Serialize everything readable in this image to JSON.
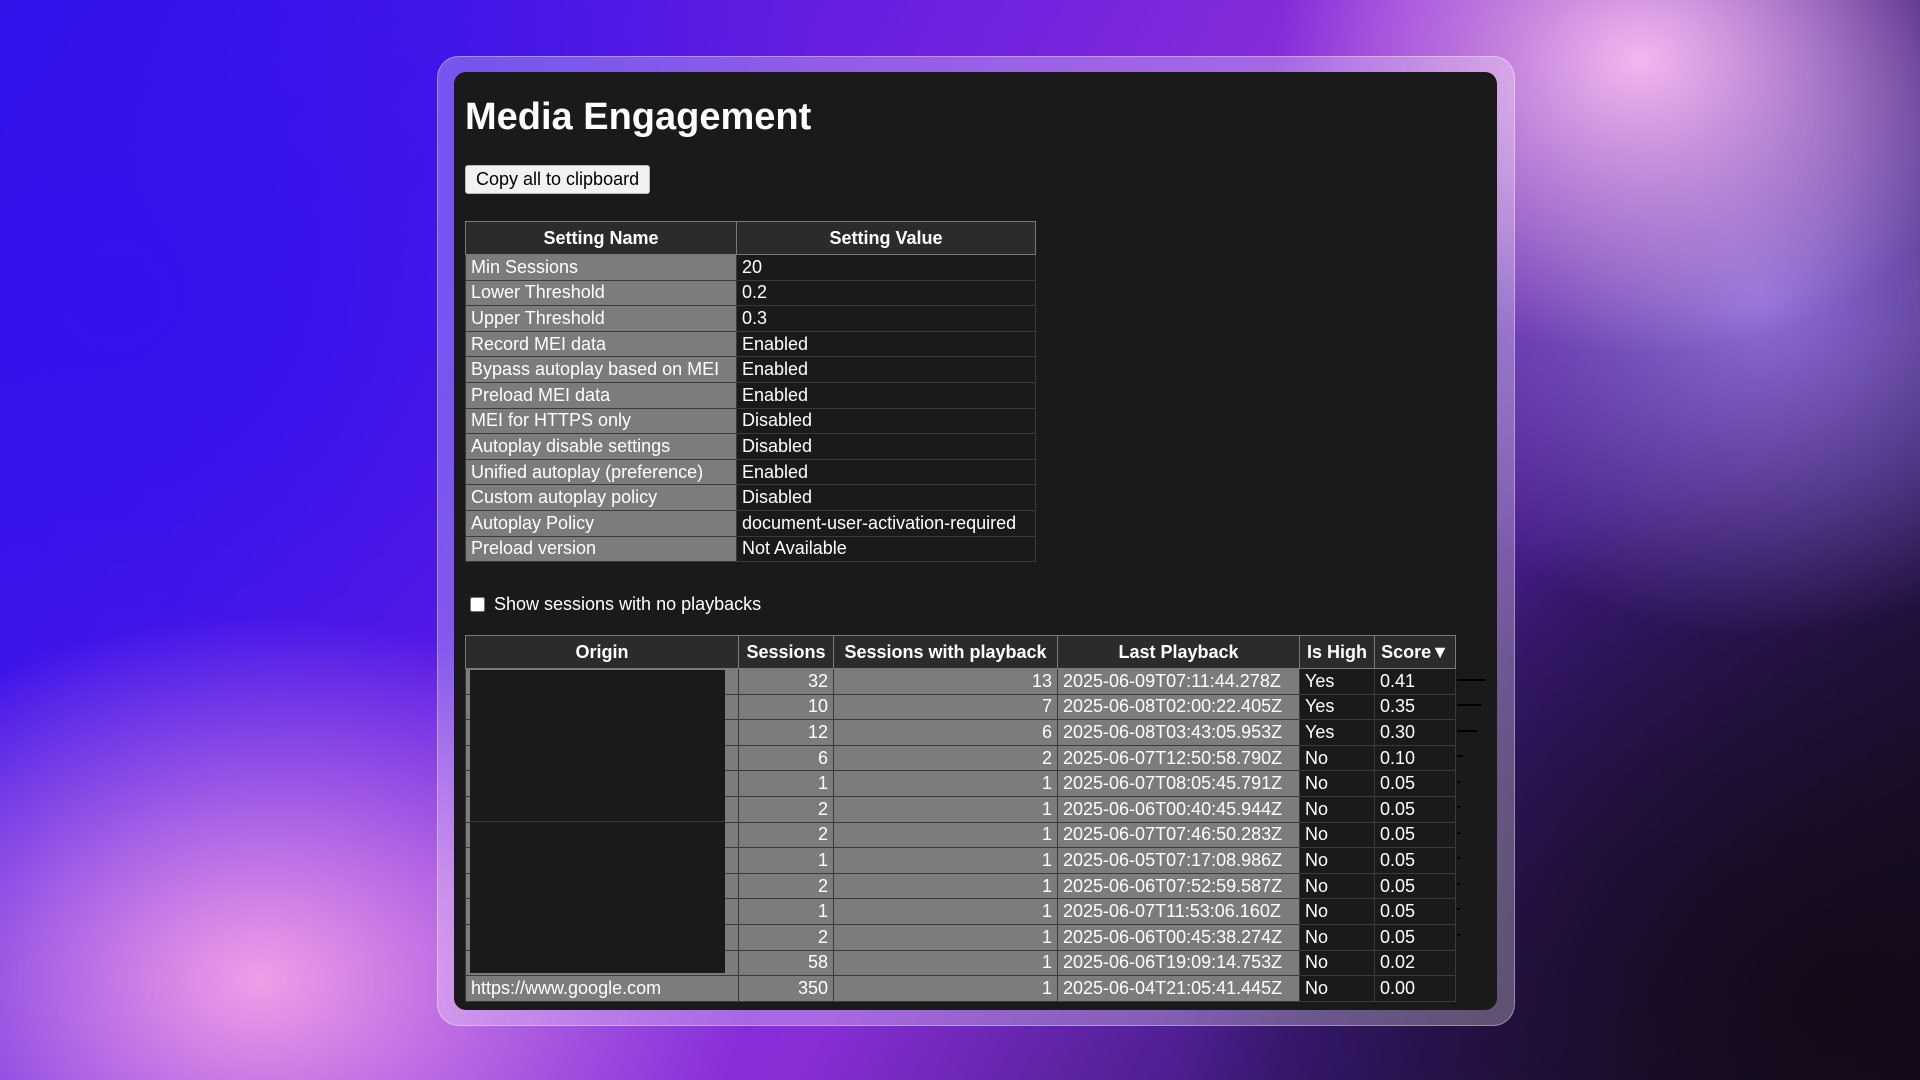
{
  "page": {
    "title": "Media Engagement",
    "copy_button": "Copy all to clipboard"
  },
  "settings": {
    "headers": [
      "Setting Name",
      "Setting Value"
    ],
    "rows": [
      {
        "name": "Min Sessions",
        "value": "20"
      },
      {
        "name": "Lower Threshold",
        "value": "0.2"
      },
      {
        "name": "Upper Threshold",
        "value": "0.3"
      },
      {
        "name": "Record MEI data",
        "value": "Enabled"
      },
      {
        "name": "Bypass autoplay based on MEI",
        "value": "Enabled"
      },
      {
        "name": "Preload MEI data",
        "value": "Enabled"
      },
      {
        "name": "MEI for HTTPS only",
        "value": "Disabled"
      },
      {
        "name": "Autoplay disable settings",
        "value": "Disabled"
      },
      {
        "name": "Unified autoplay (preference)",
        "value": "Enabled"
      },
      {
        "name": "Custom autoplay policy",
        "value": "Disabled"
      },
      {
        "name": "Autoplay Policy",
        "value": "document-user-activation-required"
      },
      {
        "name": "Preload version",
        "value": "Not Available"
      }
    ]
  },
  "show_no_playbacks": {
    "label": "Show sessions with no playbacks",
    "checked": false
  },
  "engagement": {
    "headers": [
      "Origin",
      "Sessions",
      "Sessions with playback",
      "Last Playback",
      "Is High",
      "Score▼"
    ],
    "rows": [
      {
        "origin": "",
        "sessions": "32",
        "playback": "13",
        "last": "2025-06-09T07:11:44.278Z",
        "high": "Yes",
        "score": "0.41"
      },
      {
        "origin": "",
        "sessions": "10",
        "playback": "7",
        "last": "2025-06-08T02:00:22.405Z",
        "high": "Yes",
        "score": "0.35"
      },
      {
        "origin": "",
        "sessions": "12",
        "playback": "6",
        "last": "2025-06-08T03:43:05.953Z",
        "high": "Yes",
        "score": "0.30"
      },
      {
        "origin": "",
        "sessions": "6",
        "playback": "2",
        "last": "2025-06-07T12:50:58.790Z",
        "high": "No",
        "score": "0.10"
      },
      {
        "origin": "",
        "sessions": "1",
        "playback": "1",
        "last": "2025-06-07T08:05:45.791Z",
        "high": "No",
        "score": "0.05"
      },
      {
        "origin": "",
        "sessions": "2",
        "playback": "1",
        "last": "2025-06-06T00:40:45.944Z",
        "high": "No",
        "score": "0.05"
      },
      {
        "origin": "",
        "sessions": "2",
        "playback": "1",
        "last": "2025-06-07T07:46:50.283Z",
        "high": "No",
        "score": "0.05"
      },
      {
        "origin": "",
        "sessions": "1",
        "playback": "1",
        "last": "2025-06-05T07:17:08.986Z",
        "high": "No",
        "score": "0.05"
      },
      {
        "origin": "",
        "sessions": "2",
        "playback": "1",
        "last": "2025-06-06T07:52:59.587Z",
        "high": "No",
        "score": "0.05"
      },
      {
        "origin": "",
        "sessions": "1",
        "playback": "1",
        "last": "2025-06-07T11:53:06.160Z",
        "high": "No",
        "score": "0.05"
      },
      {
        "origin": "",
        "sessions": "2",
        "playback": "1",
        "last": "2025-06-06T00:45:38.274Z",
        "high": "No",
        "score": "0.05"
      },
      {
        "origin": "",
        "sessions": "58",
        "playback": "1",
        "last": "2025-06-06T19:09:14.753Z",
        "high": "No",
        "score": "0.02"
      },
      {
        "origin": "https://www.google.com",
        "sessions": "350",
        "playback": "1",
        "last": "2025-06-04T21:05:41.445Z",
        "high": "No",
        "score": "0.00"
      }
    ]
  }
}
